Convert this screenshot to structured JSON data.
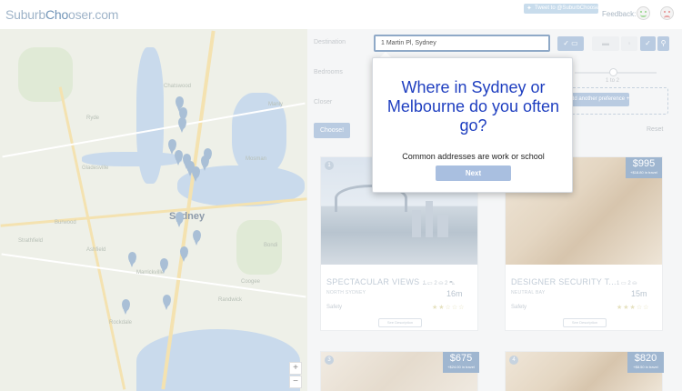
{
  "header": {
    "logo_prefix": "Suburb",
    "logo_bold": "Cho",
    "logo_rest": "oser.com",
    "tweet_label": "Tweet to @SuburbChooser",
    "feedback_label": "Feedback:"
  },
  "map": {
    "labels": [
      "Sydney",
      "Gladesville",
      "Mosman",
      "Manly",
      "Strathfield",
      "Randwick",
      "Ryde",
      "Chatswood",
      "Bondi",
      "Ashfield",
      "Burwood",
      "Marrickville",
      "Rockdale",
      "Coogee"
    ],
    "zoom_in": "+",
    "zoom_out": "−"
  },
  "form": {
    "destination_label": "Destination",
    "destination_value": "1 Martin Pl, Sydney",
    "bedrooms_label": "Bedrooms",
    "bedrooms_value": "1 to 2",
    "closer_label": "Closer",
    "preference_button": "Add another preference +",
    "choose_button": "Choose!",
    "reset_link": "Reset"
  },
  "cards": [
    {
      "rank": "1",
      "title": "SPECTACULAR VIEWS ...",
      "suburb": "NORTH SYDNEY",
      "features": "1 ▭ 2 ⛀ 2 ⛍",
      "time": "16m",
      "safety_label": "Safety",
      "stars": "★★☆☆☆",
      "see_desc": "See Description"
    },
    {
      "rank": "",
      "price": "$995",
      "price_sub": "+$18.80 in travel",
      "title": "DESIGNER SECURITY T...",
      "suburb": "NEUTRAL BAY",
      "features": "1 ▭ 2 ⛀",
      "time": "15m",
      "safety_label": "Safety",
      "stars": "★★★☆☆",
      "see_desc": "See Description"
    },
    {
      "rank": "3",
      "price": "$675",
      "price_sub": "+$24.00 in travel"
    },
    {
      "rank": "4",
      "price": "$820",
      "price_sub": "+$8.50 in travel"
    }
  ],
  "modal": {
    "title": "Where in Sydney or Melbourne do you often go?",
    "subtitle": "Common addresses are work or school",
    "next_button": "Next"
  }
}
